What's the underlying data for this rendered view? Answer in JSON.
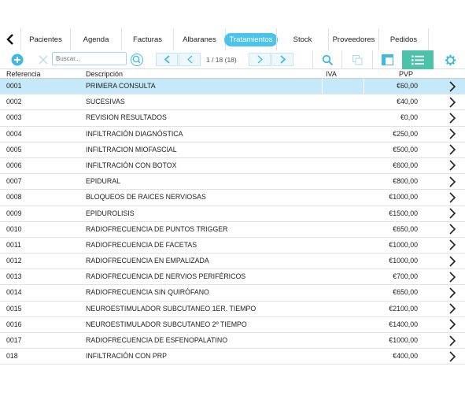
{
  "nav": {
    "tabs": [
      {
        "label": "Pacientes",
        "active": false
      },
      {
        "label": "Agenda",
        "active": false
      },
      {
        "label": "Facturas",
        "active": false
      },
      {
        "label": "Albaranes",
        "active": false
      },
      {
        "label": "Tratamientos",
        "active": true
      },
      {
        "label": "Stock",
        "active": false
      },
      {
        "label": "Proveedores",
        "active": false
      },
      {
        "label": "Pedidos",
        "active": false
      }
    ]
  },
  "toolbar": {
    "search_placeholder": "Buscar...",
    "page_counter": "1 / 18 (18)",
    "icons": [
      "add-icon",
      "clear-icon",
      "search-icon",
      "prev-page-icon",
      "next-page-icon",
      "search-icon",
      "copy-icon",
      "table-view-icon",
      "list-view-icon",
      "gear-icon"
    ]
  },
  "table": {
    "headers": {
      "ref": "Referencia",
      "desc": "Descripción",
      "iva": "IVA",
      "pvp": "PVP"
    },
    "rows": [
      {
        "ref": "0001",
        "desc": "PRIMERA CONSULTA",
        "iva": "",
        "pvp": "€60,00"
      },
      {
        "ref": "0002",
        "desc": "SUCESIVAS",
        "iva": "",
        "pvp": "€40,00"
      },
      {
        "ref": "0003",
        "desc": "REVISION RESULTADOS",
        "iva": "",
        "pvp": "€0,00"
      },
      {
        "ref": "0004",
        "desc": "INFILTRACIÓN DIAGNÓSTICA",
        "iva": "",
        "pvp": "€250,00"
      },
      {
        "ref": "0005",
        "desc": "INFILTRACION MIOFASCIAL",
        "iva": "",
        "pvp": "€500,00"
      },
      {
        "ref": "0006",
        "desc": "INFILTRACIÓN CON BOTOX",
        "iva": "",
        "pvp": "€600,00"
      },
      {
        "ref": "0007",
        "desc": "EPIDURAL",
        "iva": "",
        "pvp": "€800,00"
      },
      {
        "ref": "0008",
        "desc": "BLOQUEOS DE RAICES NERVIOSAS",
        "iva": "",
        "pvp": "€1000,00"
      },
      {
        "ref": "0009",
        "desc": "EPIDUROLISIS",
        "iva": "",
        "pvp": "€1500,00"
      },
      {
        "ref": "0010",
        "desc": "RADIOFRECUENCIA DE PUNTOS TRIGGER",
        "iva": "",
        "pvp": "€650,00"
      },
      {
        "ref": "0011",
        "desc": "RADIOFRECUENCIA DE FACETAS",
        "iva": "",
        "pvp": "€1000,00"
      },
      {
        "ref": "0012",
        "desc": "RADIOFRECUENCIA EN EMPALIZADA",
        "iva": "",
        "pvp": "€1000,00"
      },
      {
        "ref": "0013",
        "desc": "RADIOFRECUENCIA DE NERVIOS PERIFÉRICOS",
        "iva": "",
        "pvp": "€700,00"
      },
      {
        "ref": "0014",
        "desc": "RADIOFRECUENCIA SIN QUIRÓFANO",
        "iva": "",
        "pvp": "€650,00"
      },
      {
        "ref": "0015",
        "desc": "NEUROESTIMULADOR SUBCUTANEO 1ER. TIEMPO",
        "iva": "",
        "pvp": "€2100,00"
      },
      {
        "ref": "0016",
        "desc": "NEUROESTIMULADOR SUBCUTANEO 2º TIEMPO",
        "iva": "",
        "pvp": "€1400,00"
      },
      {
        "ref": "0017",
        "desc": "RADIOFRECUENCIA DE ESFENOPALATINO",
        "iva": "",
        "pvp": "€1000,00"
      },
      {
        "ref": "018",
        "desc": "INFILTRACIÓN CON PRP",
        "iva": "",
        "pvp": "€400,00"
      }
    ],
    "selected_index": 0
  },
  "colors": {
    "accent": "#4cc3ea",
    "list_button": "#4cc3a9",
    "selected_row": "#c5e9f8"
  }
}
